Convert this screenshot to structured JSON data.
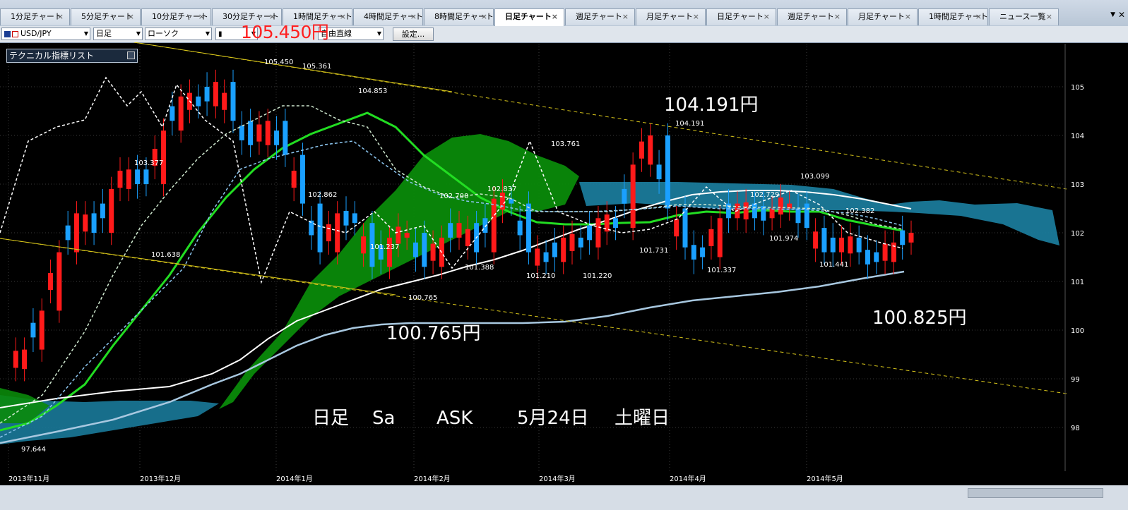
{
  "tabs": [
    {
      "label": "1分足チャート"
    },
    {
      "label": "5分足チャート"
    },
    {
      "label": "10分足チャート"
    },
    {
      "label": "30分足チャート"
    },
    {
      "label": "1時間足チャート"
    },
    {
      "label": "4時間足チャート"
    },
    {
      "label": "8時間足チャート"
    },
    {
      "label": "日足チャート",
      "active": true
    },
    {
      "label": "週足チャート"
    },
    {
      "label": "月足チャート"
    },
    {
      "label": "日足チャート"
    },
    {
      "label": "週足チャート"
    },
    {
      "label": "月足チャート"
    },
    {
      "label": "1時間足チャート"
    },
    {
      "label": "ニュース一覧"
    }
  ],
  "toolbar": {
    "symbol": "USD/JPY",
    "timeframe": "日足",
    "chart_style": "ローソク",
    "mode": "自由直線",
    "settings_label": "設定..."
  },
  "overlay_price": "105.450円",
  "indicator_list_label": "テクニカル指標リスト",
  "colors": {
    "up_candle": "#ff1a1a",
    "down_candle": "#1aa0ff",
    "ma_green": "#22dd22",
    "ma_white": "#ffffff",
    "ma_lightblue": "#a8c8e0",
    "cloud_green": "#0a8a0a",
    "cloud_blue": "#1a7a9a",
    "trendline": "#d4c21a"
  },
  "chart_data": {
    "type": "candlestick",
    "symbol": "USD/JPY",
    "timeframe": "日足",
    "ylim": [
      97.5,
      105.5
    ],
    "y_ticks": [
      "105",
      "104",
      "103",
      "102",
      "101",
      "100",
      "99",
      "98"
    ],
    "x_ticks": [
      "2013年11月",
      "2013年12月",
      "2014年1月",
      "2014年2月",
      "2014年3月",
      "2014年4月",
      "2014年5月"
    ],
    "close_path": [
      99.2,
      99.6,
      100.4,
      101.6,
      102.4,
      102.0,
      102.9,
      103.3,
      103.0,
      104.1,
      104.8,
      104.6,
      105.1,
      104.3,
      103.8,
      104.3,
      103.6,
      102.6,
      101.6,
      102.4,
      102.2,
      101.3,
      101.9,
      102.0,
      101.3,
      101.9,
      102.2,
      101.6,
      102.7,
      102.6,
      101.6,
      101.4,
      101.9,
      101.7,
      102.3,
      102.1,
      103.4,
      104.0,
      102.5,
      101.7,
      101.5,
      102.3,
      102.6,
      102.3,
      102.5,
      102.6,
      102.1,
      101.6,
      101.9,
      101.6,
      101.4,
      101.8,
      102.0
    ],
    "close_values": [
      "104.191円",
      "100.825円",
      "100.765円"
    ],
    "price_labels": [
      "105.450",
      "105.361",
      "104.853",
      "103.377",
      "102.862",
      "101.638",
      "102.700",
      "101.237",
      "102.837",
      "101.388",
      "100.765",
      "103.761",
      "101.210",
      "101.220",
      "104.191",
      "101.731",
      "101.337",
      "102.729",
      "101.974",
      "103.099",
      "102.382",
      "101.441",
      "97.644"
    ],
    "annotations": [
      "日足",
      "Sa",
      "ASK",
      "5月24日",
      "土曜日"
    ]
  }
}
